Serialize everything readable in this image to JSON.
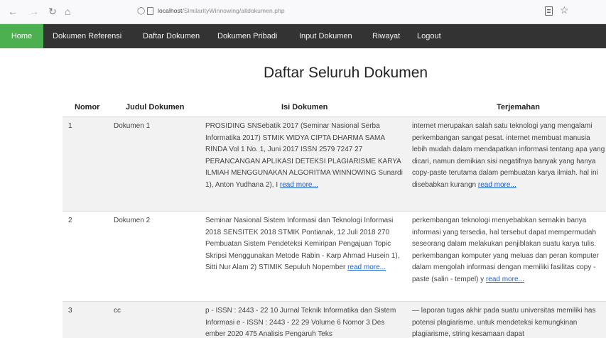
{
  "browser": {
    "url_host": "localhost",
    "url_path": "/SimilarityWinnowing/alldokumen.php"
  },
  "nav": {
    "items": [
      "Home",
      "Dokumen Referensi",
      "Daftar Dokumen",
      "Dokumen Pribadi",
      "Input Dokumen",
      "Riwayat",
      "Logout"
    ],
    "active_color": "#4caf50",
    "bar_color": "#333333"
  },
  "page_title": "Daftar Seluruh Dokumen",
  "table": {
    "headers": [
      "Nomor",
      "Judul Dokumen",
      "Isi Dokumen",
      "Terjemahan"
    ],
    "read_more_label": "read more...",
    "rows": [
      {
        "nomor": "1",
        "judul": "Dokumen 1",
        "isi": "PROSIDING SNSebatik 2017 (Seminar Nasional Serba Informatika 2017) STMIK WIDYA CIPTA DHARMA SAMA RINDA Vol 1 No. 1, Juni 2017 ISSN 2579 7247 27 PERANCANGAN APLIKASI DETEKSI PLAGIARISME KARYA ILMIAH MENGGUNAKAN ALGORITMA WINNOWING Sunardi 1), Anton Yudhana 2), I",
        "terjemahan": "internet merupakan salah satu teknologi yang mengalami perkembangan sangat pesat. internet membuat manusia lebih mudah dalam mendapatkan informasi tentang apa yang dicari, namun demikian sisi negatifnya banyak yang hanya copy-paste terutama dalam pembuatan karya ilmiah. hal ini disebabkan kurangn"
      },
      {
        "nomor": "2",
        "judul": "Dokumen 2",
        "isi": "Seminar Nasional Sistem Informasi dan Teknologi Informasi 2018 SENSITEK 2018 STMIK Pontianak, 12 Juli 2018 270 Pembuatan Sistem Pendeteksi Kemiripan Pengajuan Topic Skripsi Menggunakan Metode Rabin - Karp Ahmad Husein 1), Sitti Nur Alam 2) STIMIK Sepuluh Nopember",
        "terjemahan": "perkembangan teknologi menyebabkan semakin banya informasi yang tersedia, hal tersebut dapat mempermudah seseorang dalam melakukan penjiblakan suatu karya tulis. perkembangan komputer yang meluas dan peran komputer dalam mengolah informasi dengan memiliki fasilitas copy -paste (salin - tempel) y"
      },
      {
        "nomor": "3",
        "judul": "cc",
        "isi": "p - ISSN : 2443 - 22 10 Jurnal Teknik Informatika dan Sistem Informasi e - ISSN : 2443 - 22 29 Volume 6 Nomor 3 Des ember 2020 475 Analisis Pengaruh Teks",
        "terjemahan": "— laporan tugas akhir pada suatu universitas memiliki has potensi plagiarisme. untuk mendeteksi kemungkinan plagiarisme, string kesamaan dapat"
      }
    ]
  }
}
